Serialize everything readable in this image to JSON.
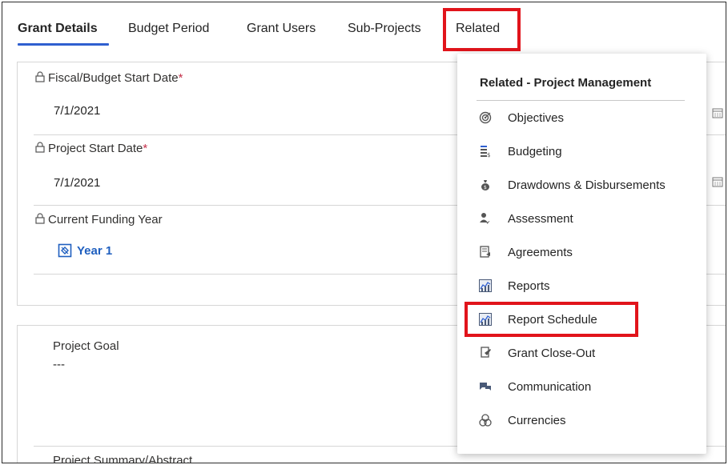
{
  "tabs": [
    {
      "label": "Grant Details",
      "active": true
    },
    {
      "label": "Budget Period",
      "active": false
    },
    {
      "label": "Grant Users",
      "active": false
    },
    {
      "label": "Sub-Projects",
      "active": false
    },
    {
      "label": "Related",
      "active": false
    }
  ],
  "details": {
    "fiscal_start": {
      "label": "Fiscal/Budget Start Date",
      "required": "*",
      "value": "7/1/2021"
    },
    "project_start": {
      "label": "Project Start Date",
      "required": "*",
      "value": "7/1/2021"
    },
    "funding_year": {
      "label": "Current Funding Year",
      "value": "Year 1"
    }
  },
  "description": {
    "goal": {
      "label": "Project Goal",
      "value": "---"
    },
    "summary": {
      "label": "Project Summary/Abstract"
    }
  },
  "related_menu": {
    "header": "Related - Project Management",
    "items": [
      {
        "label": "Objectives",
        "icon": "target-icon"
      },
      {
        "label": "Budgeting",
        "icon": "budget-icon"
      },
      {
        "label": "Drawdowns & Disbursements",
        "icon": "money-bag-icon"
      },
      {
        "label": "Assessment",
        "icon": "assessment-icon"
      },
      {
        "label": "Agreements",
        "icon": "agreement-icon"
      },
      {
        "label": "Reports",
        "icon": "report-chart-icon"
      },
      {
        "label": "Report Schedule",
        "icon": "report-chart-icon"
      },
      {
        "label": "Grant Close-Out",
        "icon": "close-out-icon"
      },
      {
        "label": "Communication",
        "icon": "chat-icon"
      },
      {
        "label": "Currencies",
        "icon": "currency-icon"
      }
    ]
  },
  "colors": {
    "accent": "#2f5fd0",
    "highlight": "#e1141b",
    "link": "#1f5fbf"
  }
}
